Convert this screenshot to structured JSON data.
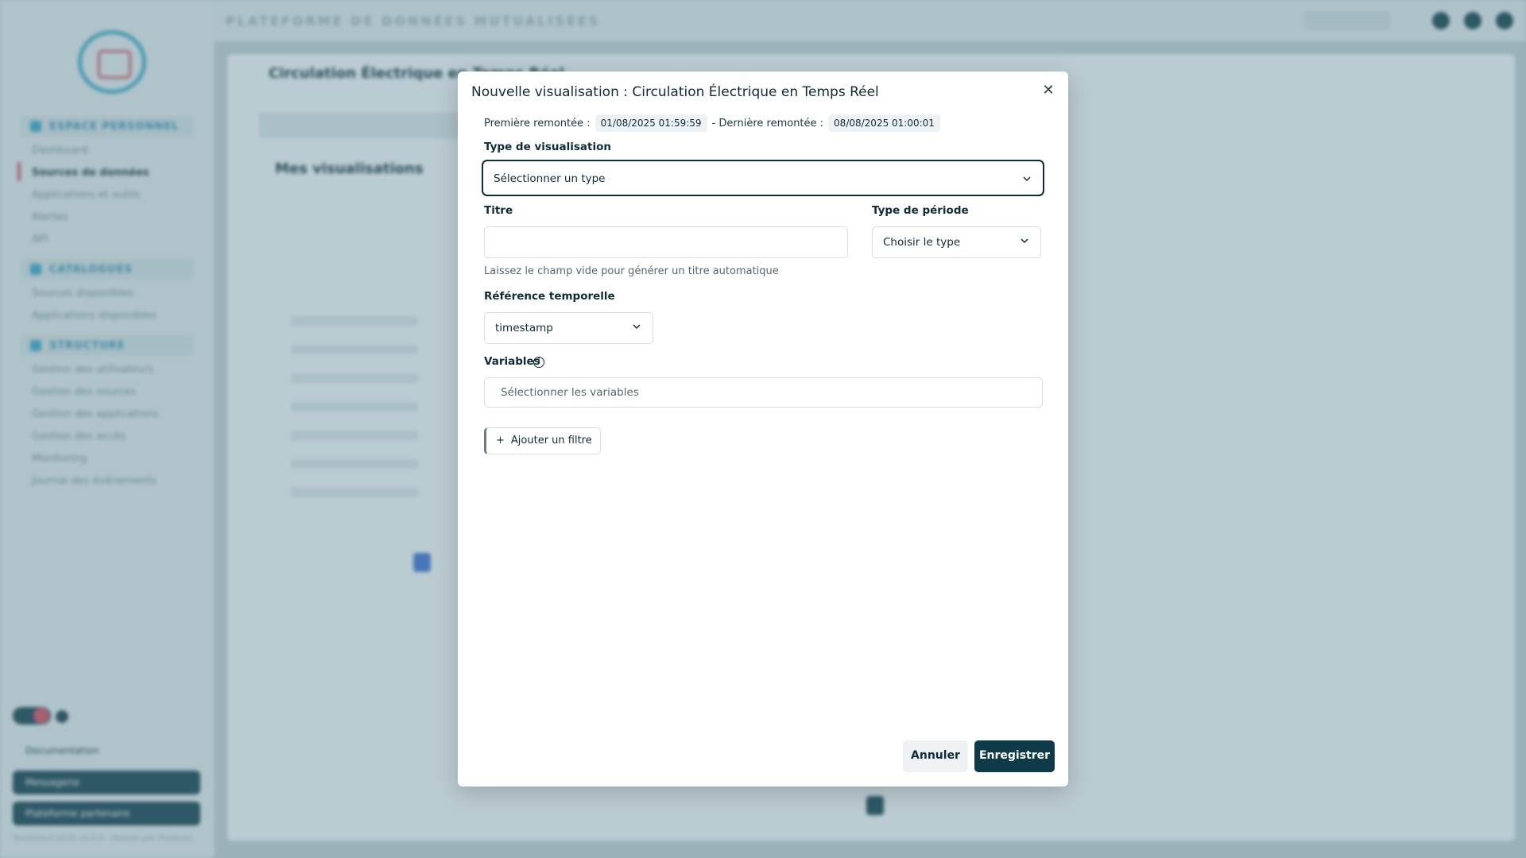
{
  "background": {
    "platform_title": "PLATEFORME DE DONNÉES MUTUALISÉES",
    "page_heading": "Circulation Électrique en Temps Réel",
    "section_title": "Mes visualisations",
    "sidebar_sections": [
      {
        "title": "ESPACE PERSONNEL",
        "items": [
          "Dashboard",
          "Sources de données",
          "Applications et outils",
          "Alertes",
          "API"
        ]
      },
      {
        "title": "CATALOGUES",
        "items": [
          "Sources disponibles",
          "Applications disponibles"
        ]
      },
      {
        "title": "STRUCTURE",
        "items": [
          "Gestion des utilisateurs",
          "Gestion des sources",
          "Gestion des applications",
          "Gestion des accès",
          "Monitoring",
          "Journal des événements"
        ]
      }
    ],
    "active_item": "Sources de données",
    "doc_link": "Documentation",
    "side_buttons": [
      "Messagerie",
      "Plateforme partenaire"
    ],
    "footer": "Territoire©2025 v4.0.0 - Réalisé par Predictiv"
  },
  "modal": {
    "title": "Nouvelle visualisation : Circulation Électrique en Temps Réel",
    "first_label": "Première remontée :",
    "first_value": "01/08/2025 01:59:59",
    "last_label": "- Dernière remontée :",
    "last_value": "08/08/2025 01:00:01",
    "type_label": "Type de visualisation",
    "type_value": "Sélectionner un type",
    "title_label": "Titre",
    "title_value": "",
    "period_label": "Type de période",
    "period_value": "Choisir le type",
    "hint": "Laissez le champ vide pour générer un titre automatique",
    "temporal_label": "Référence temporelle",
    "temporal_value": "timestamp",
    "variables_label": "Variables",
    "variables_placeholder": "Sélectionner les variables",
    "add_filter": "Ajouter un filtre",
    "cancel": "Annuler",
    "save": "Enregistrer",
    "close_icon": "close-icon"
  }
}
